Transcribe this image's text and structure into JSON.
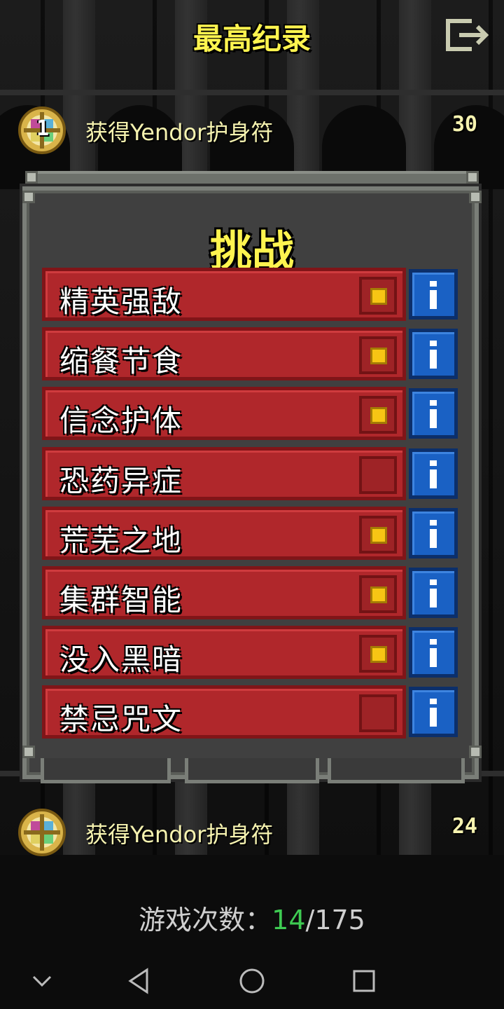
{
  "header": {
    "title": "最高纪录",
    "exit_icon": "exit-icon"
  },
  "records": [
    {
      "rank": "1",
      "description": "获得Yendor护身符",
      "depth": "30",
      "icon": "amulet-of-yendor-icon"
    },
    {
      "rank": "",
      "description": "获得Yendor护身符",
      "depth": "24",
      "icon": "amulet-of-yendor-icon"
    }
  ],
  "dialog": {
    "title": "挑战",
    "challenges": [
      {
        "name": "精英强敌",
        "enabled": true
      },
      {
        "name": "缩餐节食",
        "enabled": true
      },
      {
        "name": "信念护体",
        "enabled": true
      },
      {
        "name": "恐药异症",
        "enabled": false
      },
      {
        "name": "荒芜之地",
        "enabled": true
      },
      {
        "name": "集群智能",
        "enabled": true
      },
      {
        "name": "没入黑暗",
        "enabled": true
      },
      {
        "name": "禁忌咒文",
        "enabled": false
      }
    ],
    "info_icon": "info-icon"
  },
  "footer": {
    "games_label": "游戏次数：",
    "games_won": "14",
    "separator": "/",
    "games_total": "175"
  },
  "navbar": {
    "items": [
      "hide-keyboard-icon",
      "back-icon",
      "home-icon",
      "recents-icon"
    ]
  },
  "colors": {
    "title_yellow": "#fff44f",
    "challenge_red": "#b0272b",
    "info_blue": "#1a61c4",
    "check_gold": "#f7c514",
    "won_green": "#3ecb52"
  }
}
